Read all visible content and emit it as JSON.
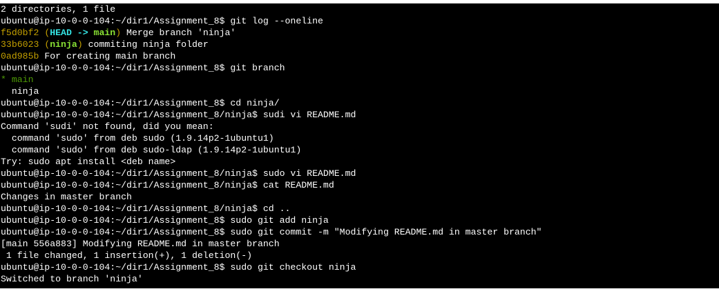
{
  "terminal": {
    "lines": [
      [
        {
          "t": "2 directories, 1 file",
          "c": ""
        }
      ],
      [
        {
          "t": "ubuntu@ip-10-0-0-104:~/dir1/Assignment_8$ git log --oneline",
          "c": ""
        }
      ],
      [
        {
          "t": "f5d0bf2",
          "c": "yellow"
        },
        {
          "t": " (",
          "c": "yellow"
        },
        {
          "t": "HEAD -> ",
          "c": "cyan-bold"
        },
        {
          "t": "main",
          "c": "green-bold"
        },
        {
          "t": ")",
          "c": "yellow"
        },
        {
          "t": " Merge branch 'ninja'",
          "c": ""
        }
      ],
      [
        {
          "t": "33b6023",
          "c": "yellow"
        },
        {
          "t": " (",
          "c": "yellow"
        },
        {
          "t": "ninja",
          "c": "green-ninja"
        },
        {
          "t": ")",
          "c": "yellow"
        },
        {
          "t": " commiting ninja folder",
          "c": ""
        }
      ],
      [
        {
          "t": "0ad985b",
          "c": "yellow"
        },
        {
          "t": " For creating main branch",
          "c": ""
        }
      ],
      [
        {
          "t": "ubuntu@ip-10-0-0-104:~/dir1/Assignment_8$ git branch",
          "c": ""
        }
      ],
      [
        {
          "t": "* ",
          "c": "green"
        },
        {
          "t": "main",
          "c": "green"
        }
      ],
      [
        {
          "t": "  ninja",
          "c": ""
        }
      ],
      [
        {
          "t": "ubuntu@ip-10-0-0-104:~/dir1/Assignment_8$ cd ninja/",
          "c": ""
        }
      ],
      [
        {
          "t": "ubuntu@ip-10-0-0-104:~/dir1/Assignment_8/ninja$ sudi vi README.md",
          "c": ""
        }
      ],
      [
        {
          "t": "Command 'sudi' not found, did you mean:",
          "c": ""
        }
      ],
      [
        {
          "t": "  command 'sudo' from deb sudo (1.9.14p2-1ubuntu1)",
          "c": ""
        }
      ],
      [
        {
          "t": "  command 'sudo' from deb sudo-ldap (1.9.14p2-1ubuntu1)",
          "c": ""
        }
      ],
      [
        {
          "t": "Try: sudo apt install <deb name>",
          "c": ""
        }
      ],
      [
        {
          "t": "ubuntu@ip-10-0-0-104:~/dir1/Assignment_8/ninja$ sudo vi README.md",
          "c": ""
        }
      ],
      [
        {
          "t": "ubuntu@ip-10-0-0-104:~/dir1/Assignment_8/ninja$ cat README.md",
          "c": ""
        }
      ],
      [
        {
          "t": "Changes in master branch",
          "c": ""
        }
      ],
      [
        {
          "t": "ubuntu@ip-10-0-0-104:~/dir1/Assignment_8/ninja$ cd ..",
          "c": ""
        }
      ],
      [
        {
          "t": "ubuntu@ip-10-0-0-104:~/dir1/Assignment_8$ sudo git add ninja",
          "c": ""
        }
      ],
      [
        {
          "t": "ubuntu@ip-10-0-0-104:~/dir1/Assignment_8$ sudo git commit -m \"Modifying README.md in master branch\"",
          "c": ""
        }
      ],
      [
        {
          "t": "[main 556a883] Modifying README.md in master branch",
          "c": ""
        }
      ],
      [
        {
          "t": " 1 file changed, 1 insertion(+), 1 deletion(-)",
          "c": ""
        }
      ],
      [
        {
          "t": "ubuntu@ip-10-0-0-104:~/dir1/Assignment_8$ sudo git checkout ninja",
          "c": ""
        }
      ],
      [
        {
          "t": "Switched to branch 'ninja'",
          "c": ""
        }
      ]
    ]
  }
}
